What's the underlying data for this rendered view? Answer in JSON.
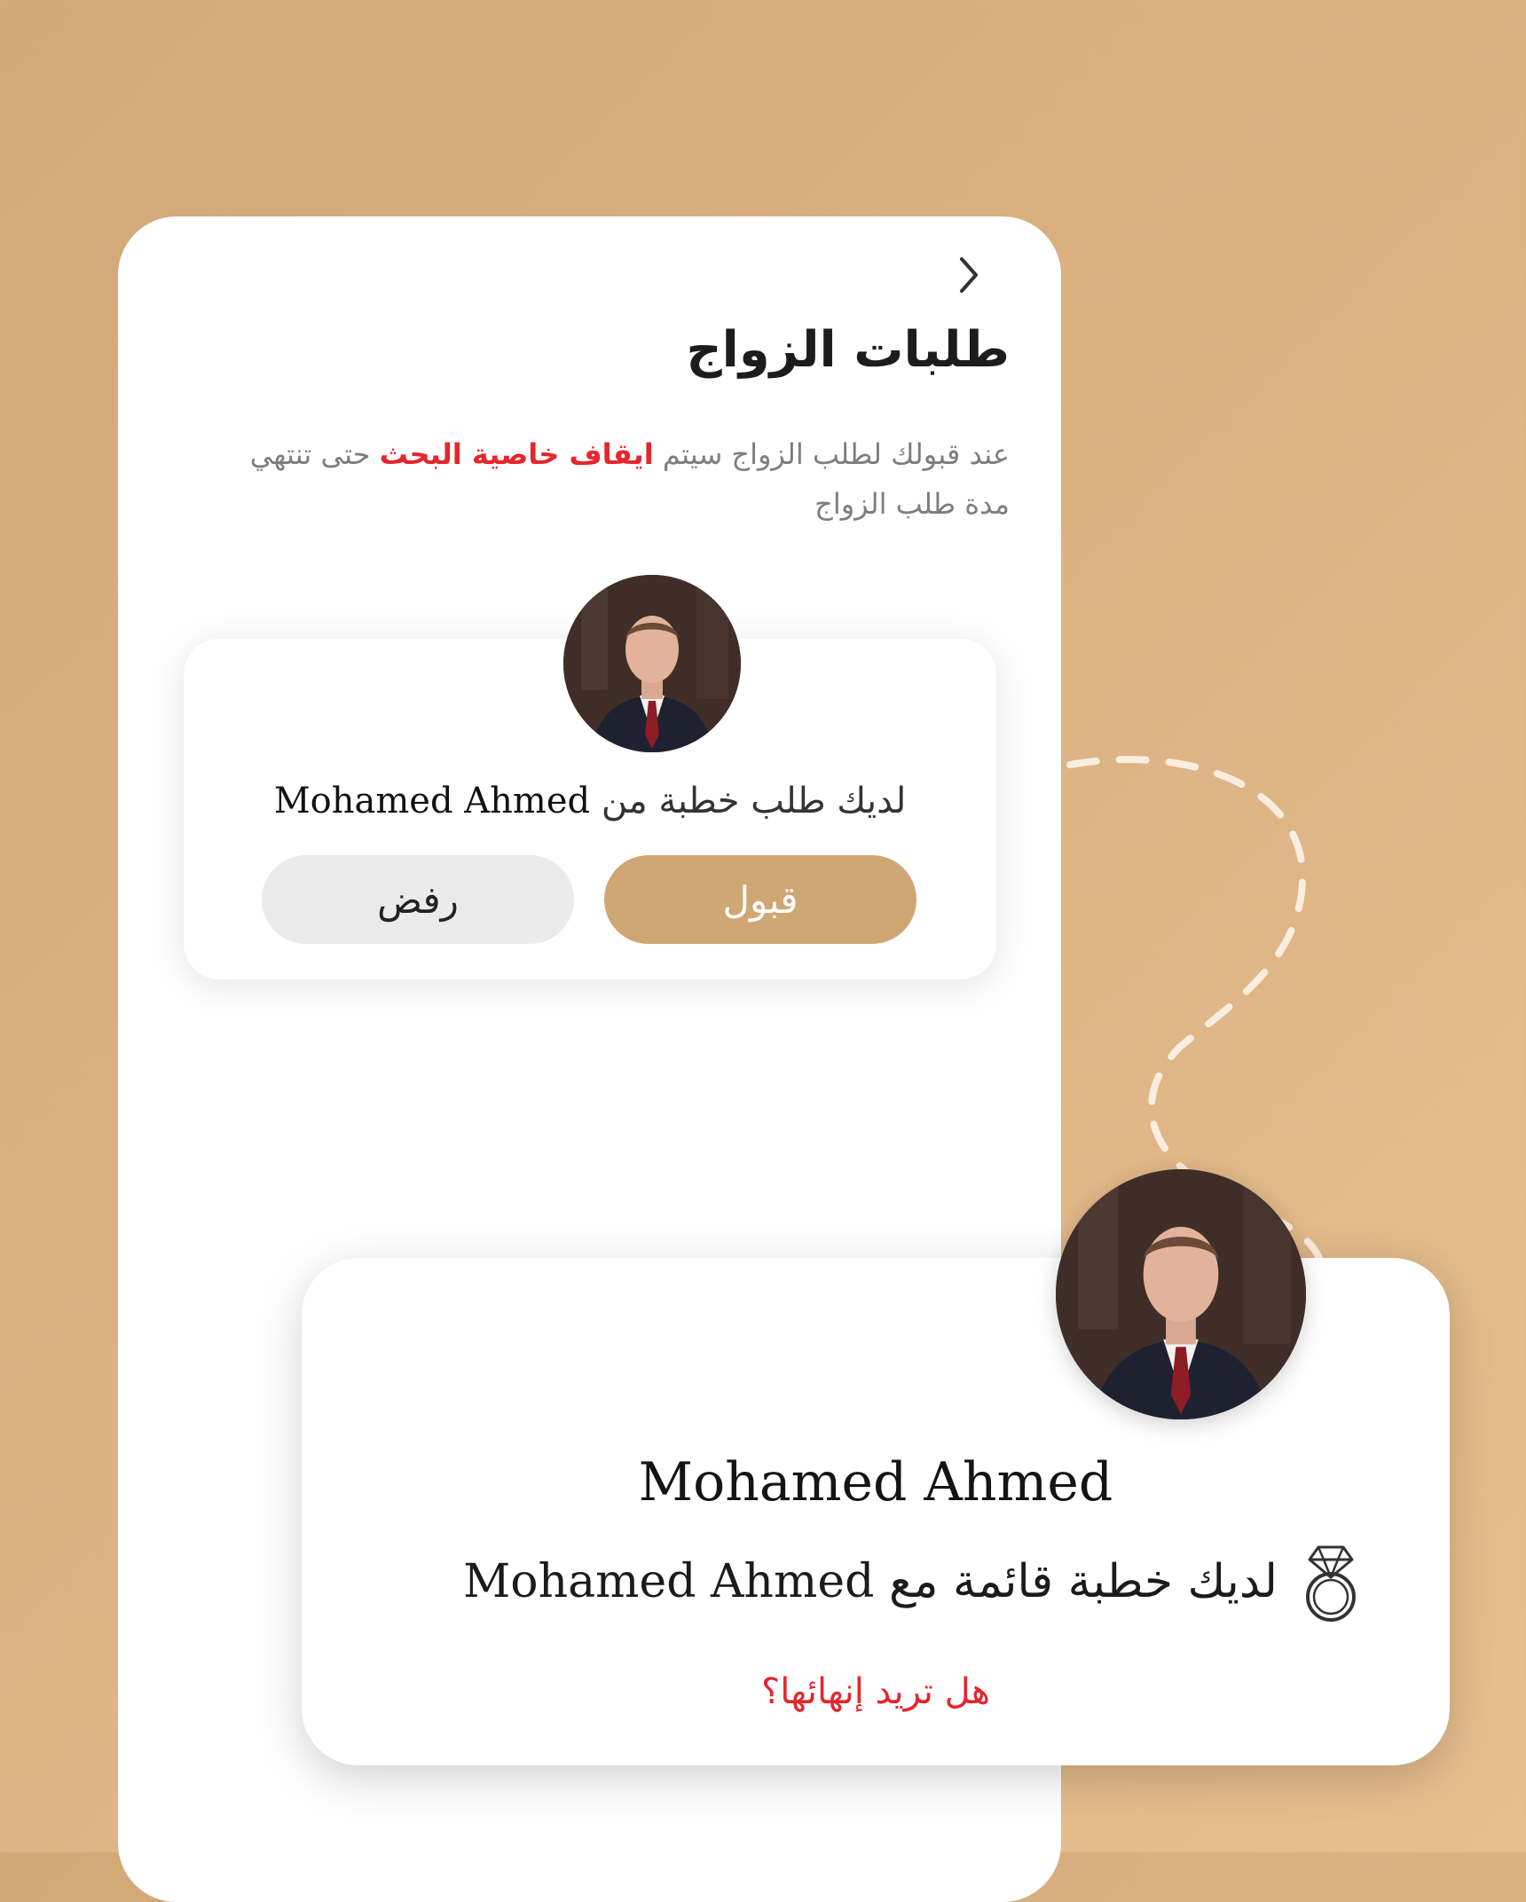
{
  "screen": {
    "title": "طلبات الزواج",
    "notice": {
      "part1": "عند قبولك لطلب الزواج سيتم ",
      "highlight": "ايقاف خاصية البحث",
      "part2": " حتى تنتهي مدة طلب الزواج"
    }
  },
  "request_card": {
    "prefix": "لديك طلب خطبة من",
    "name": "Mohamed Ahmed",
    "accept_label": "قبول",
    "reject_label": "رفض"
  },
  "engagement_card": {
    "name": "Mohamed Ahmed",
    "status_prefix": "لديك خطبة قائمة مع",
    "status_name": "Mohamed Ahmed",
    "end_question": "هل تريد إنهائها؟"
  },
  "icons": {
    "back": "chevron-right-icon",
    "ring": "diamond-ring-icon"
  },
  "colors": {
    "accent": "#d0a674",
    "highlight_red": "#e5262c",
    "background": "#dab07f"
  }
}
